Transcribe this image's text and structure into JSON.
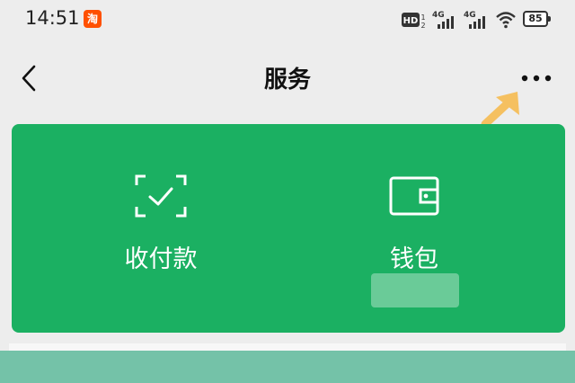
{
  "status_bar": {
    "time": "14:51",
    "app_icon_label": "淘",
    "battery": "85",
    "network_1": "4G",
    "network_2": "4G",
    "hd_label": "HD"
  },
  "nav": {
    "title": "服务",
    "back_icon": "chevron-left-icon",
    "more_icon": "more-dots-icon"
  },
  "services": [
    {
      "label": "收付款",
      "icon": "scan-check-icon"
    },
    {
      "label": "钱包",
      "icon": "wallet-icon"
    }
  ],
  "colors": {
    "card_green": "#1bb062",
    "arrow_yellow": "#f5c060",
    "bottom_overlay": "#74c2a8",
    "background": "#ededed"
  }
}
